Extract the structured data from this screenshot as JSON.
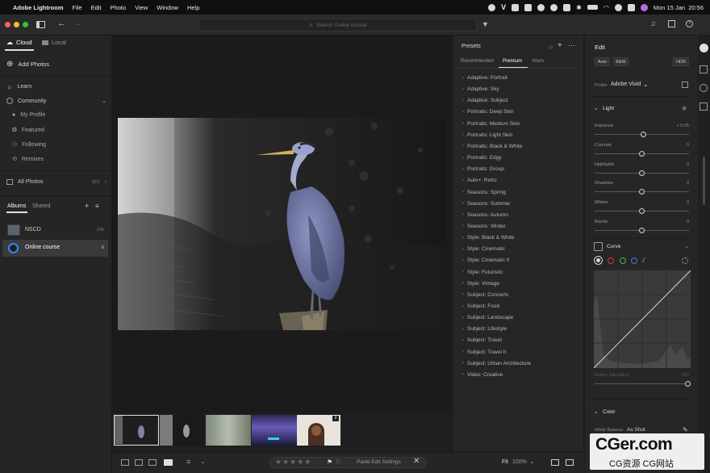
{
  "menubar": {
    "app_name": "Adobe Lightroom",
    "items": [
      "File",
      "Edit",
      "Photo",
      "View",
      "Window",
      "Help"
    ],
    "clock": "Mon 15 Jan  20:56"
  },
  "toolbar": {
    "search_placeholder": "Search Online course"
  },
  "sidebar": {
    "tab_cloud": "Cloud",
    "tab_local": "Local",
    "add_photos": "Add Photos",
    "learn": "Learn",
    "community": "Community",
    "my_profile": "My Profile",
    "featured": "Featured",
    "following": "Following",
    "remixes": "Remixes",
    "all_photos": "All Photos",
    "all_photos_count": "821",
    "albums_tab": "Albums",
    "shared_tab": "Shared",
    "albums": [
      {
        "name": "NSCD",
        "count": "206"
      },
      {
        "name": "Online course",
        "count": "6"
      }
    ]
  },
  "presets": {
    "title": "Presets",
    "tabs": [
      "Recommended",
      "Premium",
      "Yours"
    ],
    "active_tab": "Premium",
    "items": [
      "Adaptive: Portrait",
      "Adaptive: Sky",
      "Adaptive: Subject",
      "Portraits: Deep Skin",
      "Portraits: Medium Skin",
      "Portraits: Light Skin",
      "Portraits: Black & White",
      "Portraits: Edgy",
      "Portraits: Group",
      "Auto+: Retro",
      "Seasons: Spring",
      "Seasons: Summer",
      "Seasons: Autumn",
      "Seasons: Winter",
      "Style: Black & White",
      "Style: Cinematic",
      "Style: Cinematic II",
      "Style: Futuristic",
      "Style: Vintage",
      "Subject: Concerts",
      "Subject: Food",
      "Subject: Landscape",
      "Subject: Lifestyle",
      "Subject: Travel",
      "Subject: Travel II",
      "Subject: Urban Architecture",
      "Video: Creative"
    ]
  },
  "edit": {
    "title": "Edit",
    "auto": "Auto",
    "bw": "B&W",
    "hdr": "HDR",
    "profile_label": "Profile",
    "profile_value": "Adobe Vivid",
    "light_section": "Light",
    "sliders": [
      {
        "label": "Exposure",
        "value": "+ 0.05",
        "pos": 0.52
      },
      {
        "label": "Contrast",
        "value": "0",
        "pos": 0.5
      },
      {
        "label": "Highlights",
        "value": "0",
        "pos": 0.5
      },
      {
        "label": "Shadows",
        "value": "0",
        "pos": 0.5
      },
      {
        "label": "Whites",
        "value": "0",
        "pos": 0.5
      },
      {
        "label": "Blacks",
        "value": "0",
        "pos": 0.5
      }
    ],
    "curve_title": "Curve",
    "refine_saturation": "Refine Saturation",
    "refine_value": "100",
    "color_section": "Color",
    "white_balance_label": "White Balance",
    "white_balance_value": "As Shot"
  },
  "filmstrip": {
    "badge": "2"
  },
  "bottombar": {
    "paste": "Paste Edit Settings",
    "fit": "Fit",
    "zoom": "100%"
  },
  "watermark": {
    "brand": "CGer.com",
    "subtitle": "CG资源 CG网站"
  },
  "colors": {
    "accent": "#2c8ff5",
    "panel": "#262626",
    "canvas": "#1b1b1b"
  }
}
